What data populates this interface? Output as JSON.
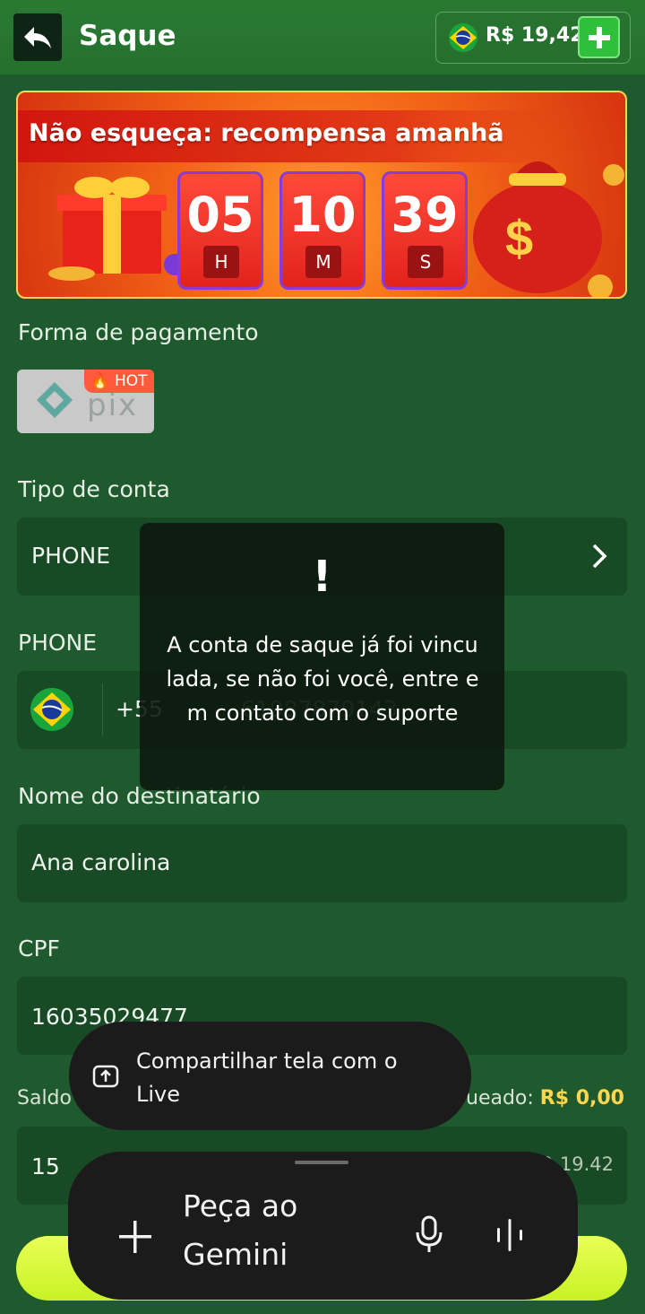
{
  "header": {
    "title": "Saque",
    "balance": "R$ 19,42",
    "back_icon": "back-arrow-icon",
    "add_icon": "plus-icon"
  },
  "banner": {
    "title": "Não esqueça: recompensa amanhã",
    "timer": [
      {
        "value": "05",
        "unit": "H"
      },
      {
        "value": "10",
        "unit": "M"
      },
      {
        "value": "39",
        "unit": "S"
      }
    ]
  },
  "payment": {
    "label": "Forma de pagamento",
    "method": "pix",
    "badge": "HOT"
  },
  "account_type": {
    "label": "Tipo de conta",
    "value": "PHONE"
  },
  "phone": {
    "label": "PHONE",
    "prefix": "+55",
    "value": "61987879143"
  },
  "recipient": {
    "label": "Nome do destinatário",
    "value": "Ana carolina"
  },
  "cpf": {
    "label": "CPF",
    "value": "16035029477"
  },
  "saldo": {
    "left_label": "Saldo",
    "right_label": "ueado:",
    "right_amount": "R$ 0,00"
  },
  "amount": {
    "value": "15",
    "range": "0-19.42"
  },
  "toast": {
    "icon": "!",
    "message": "A conta de saque já foi vinculada, se não foi você, entre em contato com o suporte"
  },
  "share_live": {
    "text": "Compartilhar tela com o Live"
  },
  "gemini": {
    "placeholder": "Peça ao Gemini"
  },
  "colors": {
    "background": "#1f5a2f",
    "field": "#194a26",
    "accent_yellow": "#ffd64d",
    "button_lime": "#d8f83a"
  }
}
